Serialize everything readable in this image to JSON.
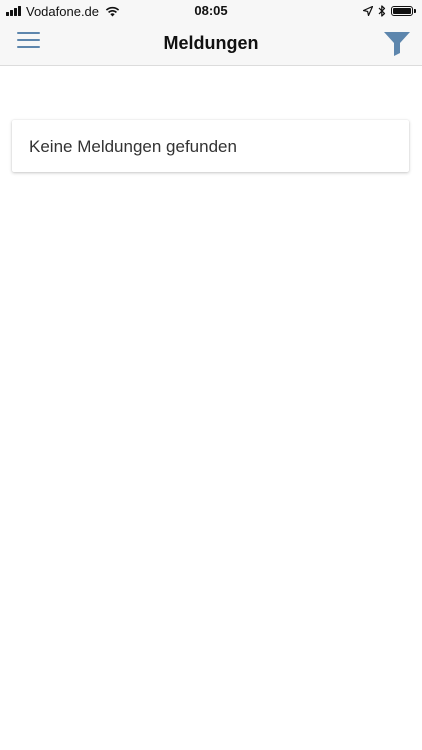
{
  "status_bar": {
    "carrier": "Vodafone.de",
    "time": "08:05",
    "icons": [
      "signal-icon",
      "wifi-icon",
      "location-arrow-icon",
      "bluetooth-icon",
      "battery-icon"
    ],
    "battery_level": 1.0
  },
  "header": {
    "title": "Meldungen",
    "menu_icon": "hamburger-menu-icon",
    "filter_icon": "filter-funnel-icon",
    "accent_color": "#5d86ad"
  },
  "content": {
    "empty_message": "Keine Meldungen gefunden"
  }
}
